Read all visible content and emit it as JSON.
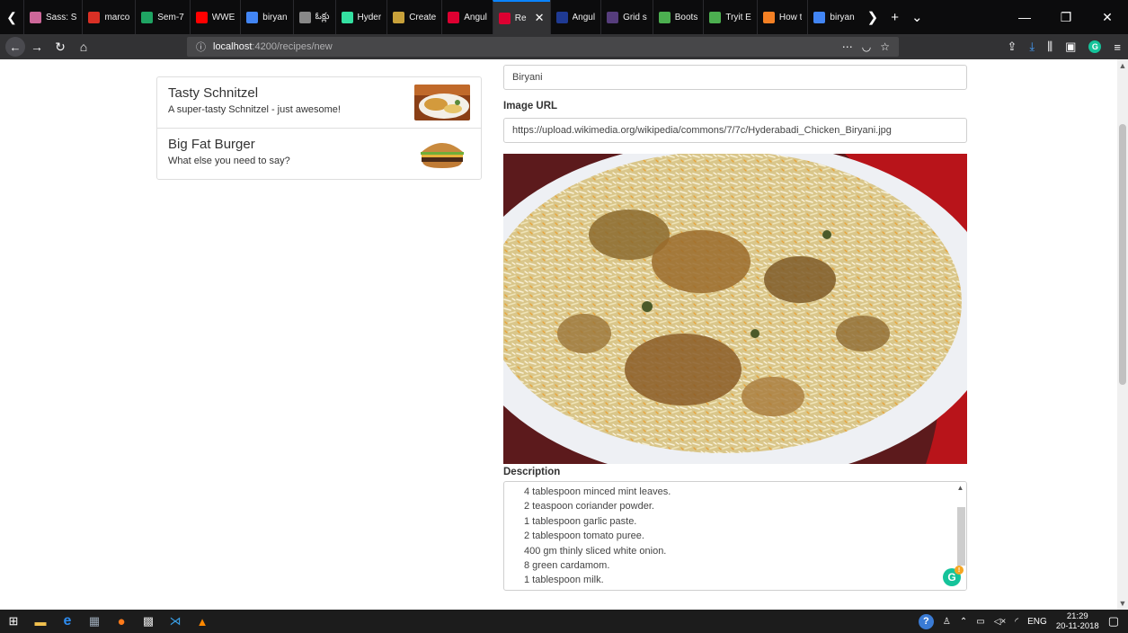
{
  "browser": {
    "tabs": [
      {
        "title": "Sass: S",
        "icon": "sass-icon",
        "color": "#cd6799"
      },
      {
        "title": "marco",
        "icon": "gmail-icon",
        "color": "#d93025"
      },
      {
        "title": "Sem-7",
        "icon": "drive-icon",
        "color": "#1fa463"
      },
      {
        "title": "WWE",
        "icon": "youtube-icon",
        "color": "#ff0000"
      },
      {
        "title": "biryan",
        "icon": "google-icon",
        "color": "#4285f4"
      },
      {
        "title": "ఓక్లు",
        "icon": "wikipedia-icon",
        "color": "#888888"
      },
      {
        "title": "Hyder",
        "icon": "tripadvisor-icon",
        "color": "#34e0a1"
      },
      {
        "title": "Create",
        "icon": "cup-icon",
        "color": "#c8a13a"
      },
      {
        "title": "Angul",
        "icon": "angular-icon",
        "color": "#dd0031"
      },
      {
        "title": "Re",
        "icon": "angular-icon",
        "color": "#dd0031",
        "active": true
      },
      {
        "title": "Angul",
        "icon": "mdn-icon",
        "color": "#1f3a93"
      },
      {
        "title": "Grid s",
        "icon": "bootstrap-icon",
        "color": "#563d7c"
      },
      {
        "title": "Boots",
        "icon": "w3schools-icon",
        "color": "#4caf50"
      },
      {
        "title": "Tryit E",
        "icon": "w3schools-icon",
        "color": "#4caf50"
      },
      {
        "title": "How t",
        "icon": "stackoverflow-icon",
        "color": "#f48024"
      },
      {
        "title": "biryan",
        "icon": "google-icon",
        "color": "#4285f4"
      }
    ],
    "url_host": "localhost",
    "url_path": ":4200/recipes/new"
  },
  "recipes": [
    {
      "name": "Tasty Schnitzel",
      "description": "A super-tasty Schnitzel - just awesome!"
    },
    {
      "name": "Big Fat Burger",
      "description": "What else you need to say?"
    }
  ],
  "form": {
    "name_value": "Biryani",
    "image_url_label": "Image URL",
    "image_url_value": "https://upload.wikimedia.org/wikipedia/commons/7/7c/Hyderabadi_Chicken_Biryani.jpg",
    "description_label": "Description",
    "description_lines": [
      "4 tablespoon minced mint leaves.",
      "2 teaspoon coriander powder.",
      "1 tablespoon garlic paste.",
      "2 tablespoon tomato puree.",
      "400 gm thinly sliced white onion.",
      "8 green cardamom.",
      "1 tablespoon milk."
    ]
  },
  "taskbar": {
    "language": "ENG",
    "time": "21:29",
    "date": "20-11-2018"
  }
}
